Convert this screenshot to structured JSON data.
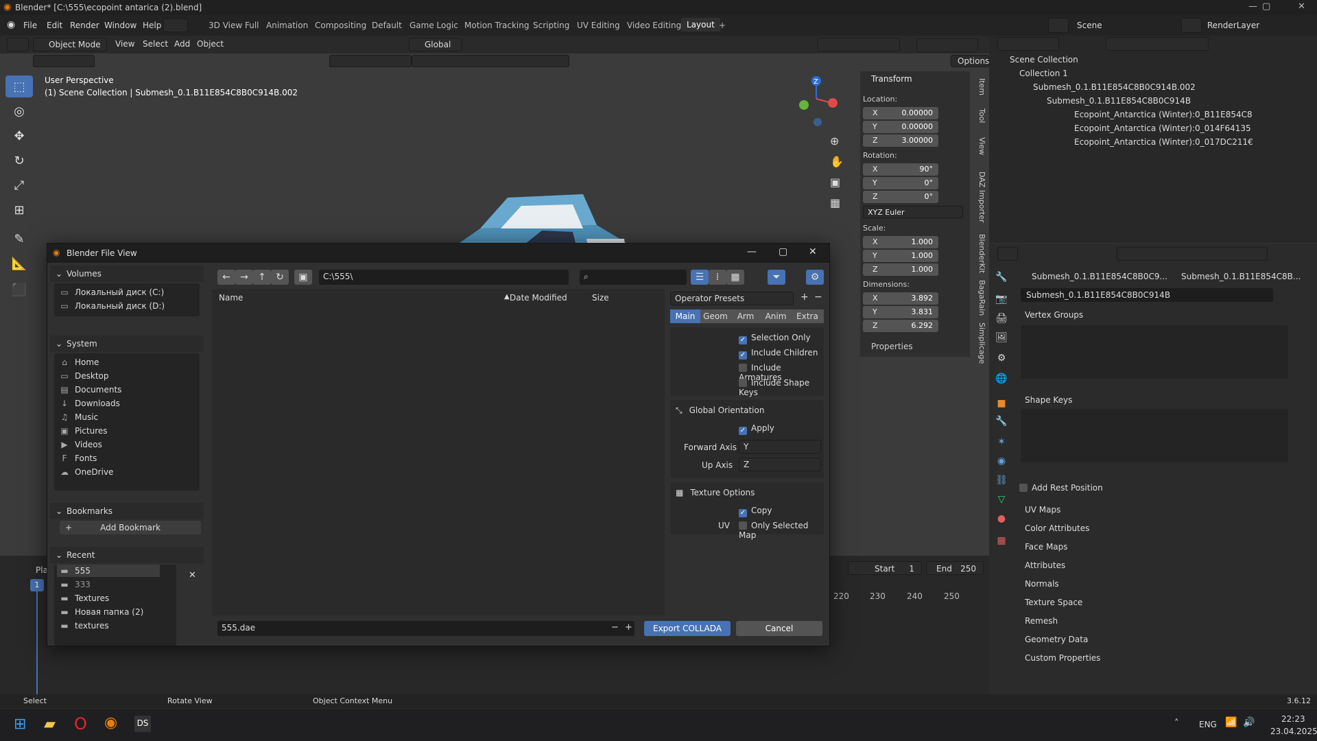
{
  "window": {
    "title": "Blender* [C:\\555\\ecopoint antarica (2).blend]"
  },
  "menu": [
    "File",
    "Edit",
    "Render",
    "Window",
    "Help"
  ],
  "workspaces": [
    "3D View Full",
    "Animation",
    "Compositing",
    "Default",
    "Game Logic",
    "Motion Tracking",
    "Scripting",
    "UV Editing",
    "Video Editing",
    "Layout"
  ],
  "scene": {
    "name": "Scene",
    "layer": "RenderLayer"
  },
  "viewport_header": {
    "mode": "Object Mode",
    "menus": [
      "View",
      "Select",
      "Add",
      "Object"
    ],
    "orientation": "Global",
    "options": "Options"
  },
  "viewport": {
    "perspective": "User Perspective",
    "collection_info": "(1) Scene Collection | Submesh_0.1.B11E854C8B0C914B.002"
  },
  "transform": {
    "title": "Transform",
    "location_label": "Location:",
    "location": [
      {
        "k": "X",
        "v": "0.00000"
      },
      {
        "k": "Y",
        "v": "0.00000"
      },
      {
        "k": "Z",
        "v": "3.00000"
      }
    ],
    "rotation_label": "Rotation:",
    "rotation": [
      {
        "k": "X",
        "v": "90°"
      },
      {
        "k": "Y",
        "v": "0°"
      },
      {
        "k": "Z",
        "v": "0°"
      }
    ],
    "rotation_mode": "XYZ Euler",
    "scale_label": "Scale:",
    "scale": [
      {
        "k": "X",
        "v": "1.000"
      },
      {
        "k": "Y",
        "v": "1.000"
      },
      {
        "k": "Z",
        "v": "1.000"
      }
    ],
    "dimensions_label": "Dimensions:",
    "dimensions": [
      {
        "k": "X",
        "v": "3.892"
      },
      {
        "k": "Y",
        "v": "3.831"
      },
      {
        "k": "Z",
        "v": "6.292"
      }
    ],
    "properties": "Properties"
  },
  "side_tabs": [
    "Item",
    "Tool",
    "View",
    "DAZ Importer",
    "BlenderKit",
    "BagaRain",
    "Simplicage"
  ],
  "outliner": {
    "root": "Scene Collection",
    "collection": "Collection 1",
    "object": "Submesh_0.1.B11E854C8B0C914B.002",
    "mesh": "Submesh_0.1.B11E854C8B0C914B",
    "materials": [
      "Ecopoint_Antarctica (Winter):0_B11E854C8",
      "Ecopoint_Antarctica (Winter):0_014F64135",
      "Ecopoint_Antarctica (Winter):0_017DC211€"
    ]
  },
  "properties": {
    "breadcrumb1": "Submesh_0.1.B11E854C8B0C9...",
    "breadcrumb2": "Submesh_0.1.B11E854C8B...",
    "mesh_name": "Submesh_0.1.B11E854C8B0C914B",
    "vertex_groups": "Vertex Groups",
    "shape_keys": "Shape Keys",
    "add_rest_position": "Add Rest Position",
    "sections": [
      "UV Maps",
      "Color Attributes",
      "Face Maps",
      "Attributes",
      "Normals",
      "Texture Space",
      "Remesh",
      "Geometry Data",
      "Custom Properties"
    ]
  },
  "timeline": {
    "playback": "Pla",
    "current_frame": "1",
    "start_label": "Start",
    "start": "1",
    "end_label": "End",
    "end": "250",
    "ticks": [
      "220",
      "230",
      "240",
      "250"
    ]
  },
  "dialog": {
    "title": "Blender File View",
    "volumes_title": "Volumes",
    "volumes": [
      "Локальный диск (C:)",
      "Локальный диск (D:)"
    ],
    "system_title": "System",
    "system": [
      "Home",
      "Desktop",
      "Documents",
      "Downloads",
      "Music",
      "Pictures",
      "Videos",
      "Fonts",
      "OneDrive"
    ],
    "bookmarks_title": "Bookmarks",
    "add_bookmark": "Add Bookmark",
    "recent_title": "Recent",
    "recent": [
      "555",
      "333",
      "Textures",
      "Новая папка (2)",
      "textures"
    ],
    "path": "C:\\555\\",
    "columns": {
      "name": "Name",
      "date": "Date Modified",
      "size": "Size"
    },
    "filename": "555.dae",
    "export": "Export COLLADA",
    "cancel": "Cancel",
    "presets": "Operator Presets",
    "tabs": [
      "Main",
      "Geom",
      "Arm",
      "Anim",
      "Extra"
    ],
    "options": [
      {
        "label": "Selection Only",
        "on": true
      },
      {
        "label": "Include Children",
        "on": true
      },
      {
        "label": "Include Armatures",
        "on": false
      },
      {
        "label": "Include Shape Keys",
        "on": false
      }
    ],
    "global_orientation": "Global Orientation",
    "apply": "Apply",
    "forward_axis_label": "Forward Axis",
    "forward_axis": "Y",
    "up_axis_label": "Up Axis",
    "up_axis": "Z",
    "texture_options": "Texture Options",
    "copy": "Copy",
    "uv_label": "UV",
    "only_selected_map": "Only Selected Map"
  },
  "status": {
    "select": "Select",
    "rotate": "Rotate View",
    "context": "Object Context Menu",
    "version": "3.6.12"
  },
  "taskbar": {
    "lang": "ENG",
    "time": "22:23",
    "date": "23.04.2025"
  }
}
